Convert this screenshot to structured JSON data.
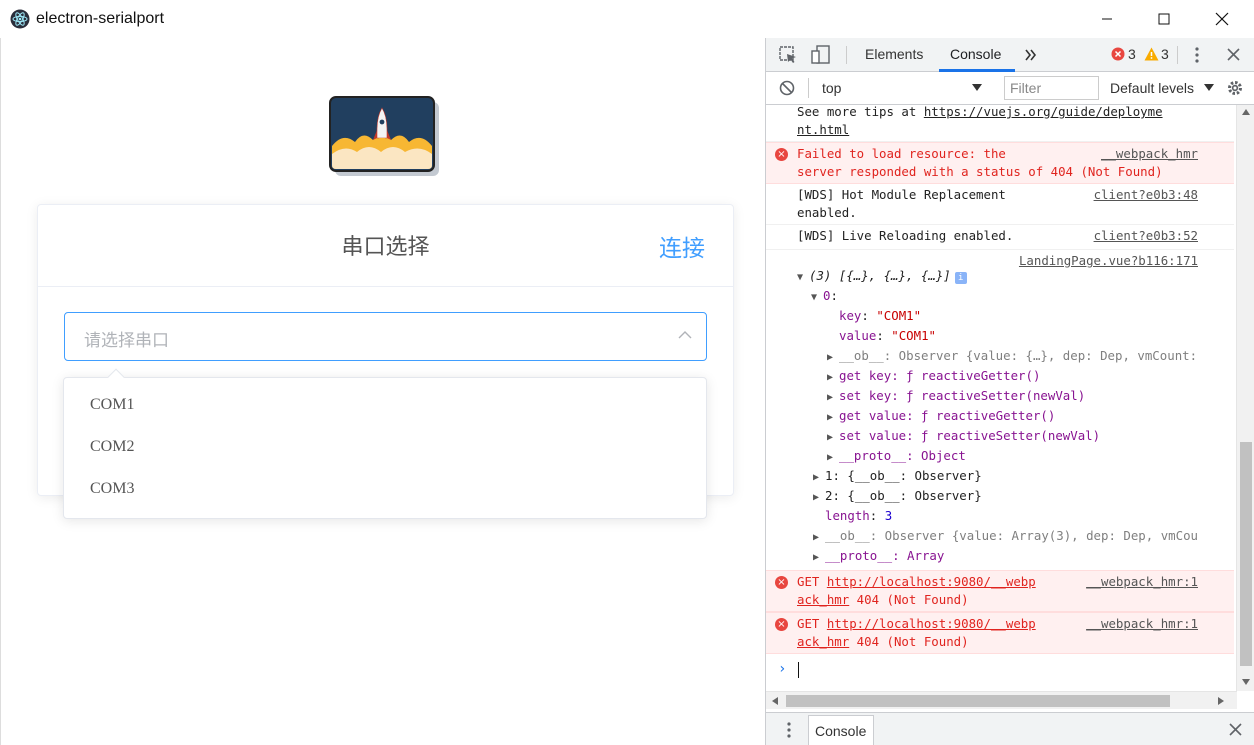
{
  "window": {
    "title": "electron-serialport"
  },
  "card": {
    "title": "串口选择",
    "connect_label": "连接"
  },
  "select": {
    "placeholder": "请选择串口",
    "options": [
      "COM1",
      "COM2",
      "COM3"
    ]
  },
  "devtools": {
    "tabs": [
      "Elements",
      "Console"
    ],
    "active_tab": "Console",
    "error_count": "3",
    "warning_count": "3",
    "context": "top",
    "filter_placeholder": "Filter",
    "levels": "Default levels",
    "drawer_tab": "Console"
  },
  "console": {
    "tip_text": "See more tips at ",
    "tip_link": "https://vuejs.org/guide/deployme",
    "tip_link2": "nt.html",
    "err1_line1": "Failed to load resource: the",
    "err1_line2": "server responded with a status of 404 (Not Found)",
    "err1_src": "__webpack_hmr",
    "wds1_line1": "[WDS] Hot Module Replacement",
    "wds1_line2": "enabled.",
    "wds1_src": "client?e0b3:48",
    "wds2_line1": "[WDS] Live Reloading enabled.",
    "wds2_src": "client?e0b3:52",
    "log_src": "LandingPage.vue?b116:171",
    "array_summary": "(3) [{…}, {…}, {…}]",
    "item0_index": "0",
    "key_label": "key",
    "key_value": "\"COM1\"",
    "value_label": "value",
    "value_value": "\"COM1\"",
    "ob_line": "__ob__: Observer {value: {…}, dep: Dep, vmCount:",
    "get_key": "get key: ƒ reactiveGetter()",
    "set_key": "set key: ƒ reactiveSetter(newVal)",
    "get_value": "get value: ƒ reactiveGetter()",
    "set_value": "set value: ƒ reactiveSetter(newVal)",
    "proto_obj": "__proto__: Object",
    "item1": "1: {__ob__: Observer}",
    "item2": "2: {__ob__: Observer}",
    "length_label": "length",
    "length_value": "3",
    "arr_ob": "__ob__: Observer {value: Array(3), dep: Dep, vmCou",
    "arr_proto": "__proto__: Array",
    "get_err_prefix": "GET ",
    "get_err_link": "http://localhost:9080/__webp",
    "get_err_link2": "ack_hmr",
    "get_err_status": " 404 (Not Found)",
    "get_err_src": "__webpack_hmr:1"
  }
}
